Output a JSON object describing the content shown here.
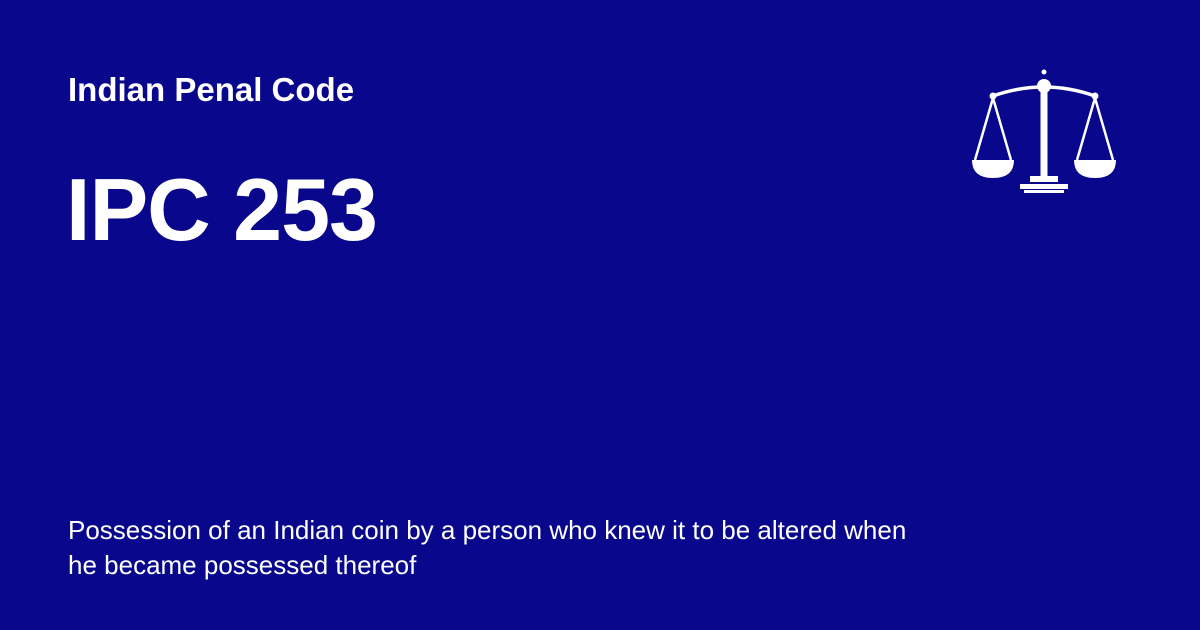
{
  "card": {
    "eyebrow": "Indian Penal Code",
    "title": "IPC 253",
    "description": "Possession of an Indian coin by a person who knew it to be altered when he became possessed thereof"
  },
  "logo": {
    "icon": "scales-of-justice-icon"
  },
  "colors": {
    "background": "#09078C",
    "text": "#FFFFFF"
  }
}
